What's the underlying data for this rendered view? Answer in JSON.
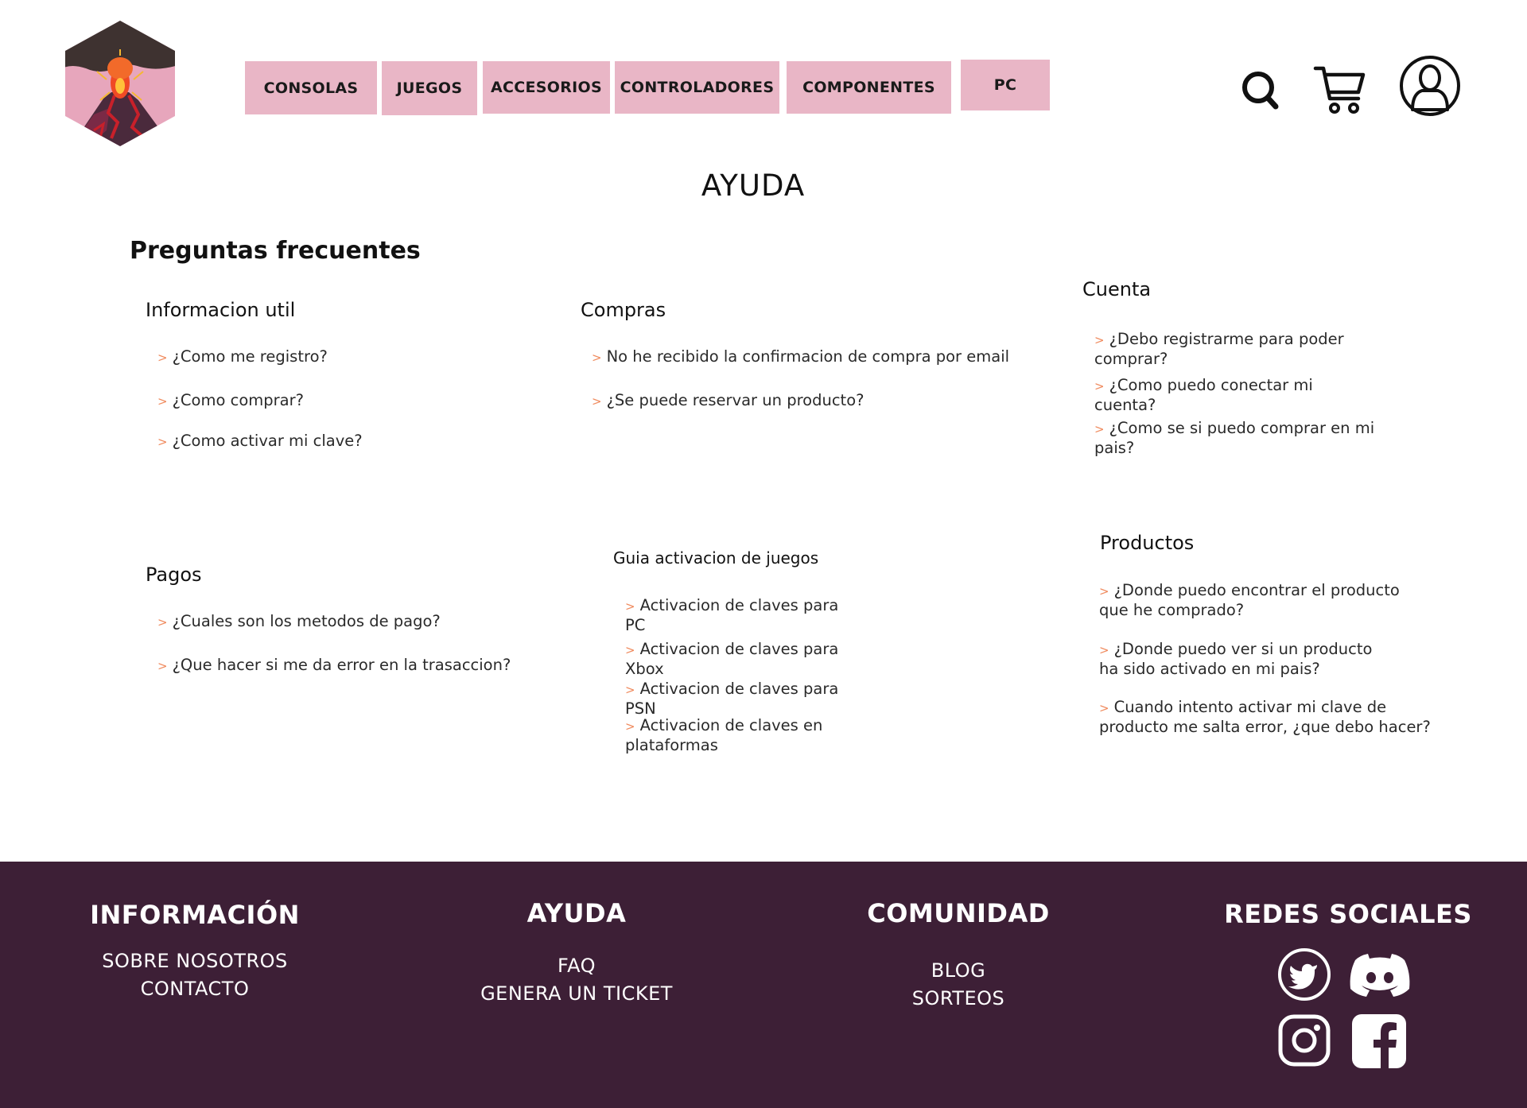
{
  "header": {
    "nav": [
      {
        "label": "CONSOLAS"
      },
      {
        "label": "JUEGOS"
      },
      {
        "label": "ACCESORIOS"
      },
      {
        "label": "CONTROLADORES"
      },
      {
        "label": "COMPONENTES"
      },
      {
        "label": "PC"
      }
    ],
    "icons": [
      "search-icon",
      "cart-icon",
      "user-account-icon"
    ]
  },
  "main": {
    "title": "AYUDA",
    "section_title": "Preguntas frecuentes",
    "arrow": ">",
    "categories": {
      "info": {
        "title": "Informacion util",
        "items": [
          "¿Como me registro?",
          "¿Como comprar?",
          "¿Como activar mi clave?"
        ]
      },
      "compras": {
        "title": "Compras",
        "items": [
          "No he recibido la confirmacion de compra por email",
          "¿Se puede reservar un producto?"
        ]
      },
      "cuenta": {
        "title": "Cuenta",
        "items": [
          "¿Debo registrarme para poder comprar?",
          "¿Como puedo conectar mi cuenta?",
          "¿Como se si puedo comprar en mi pais?"
        ]
      },
      "pagos": {
        "title": "Pagos",
        "items": [
          "¿Cuales son los metodos de pago?",
          "¿Que hacer si me da error en la trasaccion?"
        ]
      },
      "guia": {
        "title": "Guia activacion de juegos",
        "items": [
          "Activacion de claves para PC",
          "Activacion de claves para Xbox",
          "Activacion de claves para PSN",
          "Activacion de claves en plataformas"
        ]
      },
      "productos": {
        "title": "Productos",
        "items": [
          "¿Donde puedo encontrar el producto que he comprado?",
          "¿Donde puedo ver si un producto ha sido activado en mi pais?",
          "Cuando intento activar mi clave  de producto me salta error, ¿que debo hacer?"
        ]
      }
    }
  },
  "footer": {
    "informacion": {
      "title": "INFORMACIÓN",
      "links": [
        "SOBRE NOSOTROS",
        "CONTACTO"
      ]
    },
    "ayuda": {
      "title": "AYUDA",
      "links": [
        "FAQ",
        "GENERA UN TICKET"
      ]
    },
    "comunidad": {
      "title": "COMUNIDAD",
      "links": [
        "BLOG",
        "SORTEOS"
      ]
    },
    "redes": {
      "title": "REDES SOCIALES",
      "icons": [
        "twitter-icon",
        "discord-icon",
        "instagram-icon",
        "facebook-icon"
      ]
    }
  },
  "colors": {
    "nav_bg": "#e9b6c6",
    "footer_bg": "#3d1f36",
    "arrow": "#f08a5d"
  }
}
